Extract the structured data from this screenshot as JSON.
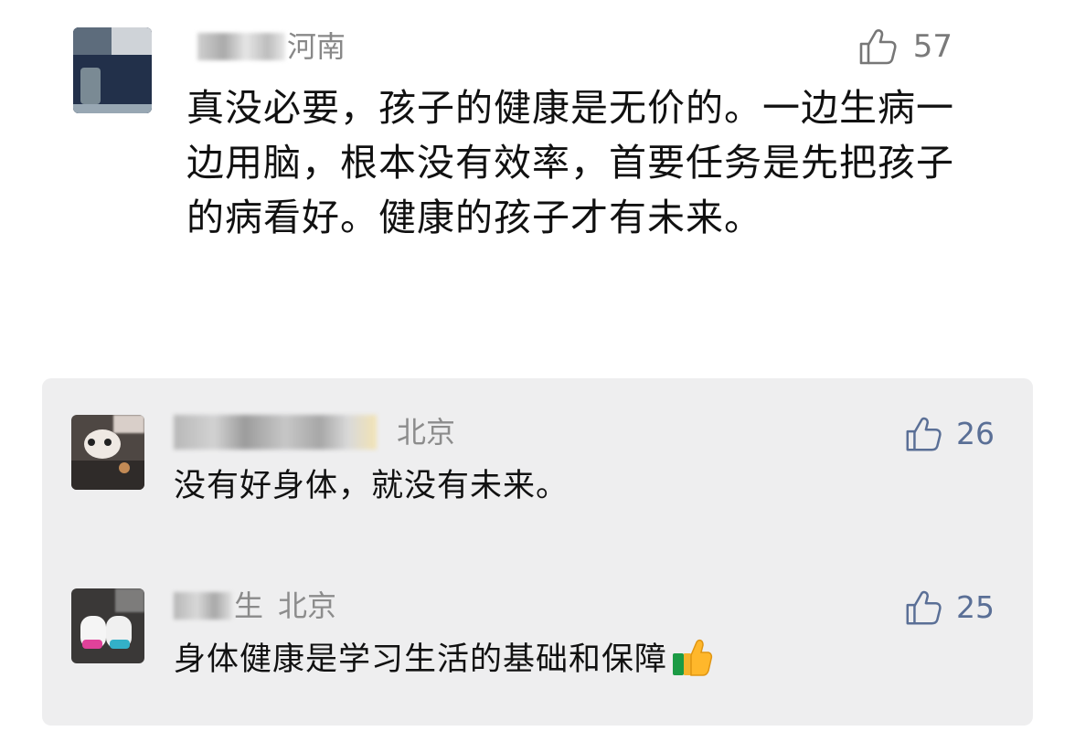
{
  "main_comment": {
    "avatar": "avatar-image",
    "user_name_tail": "",
    "location": "河南",
    "likes": "57",
    "text": "真没必要，孩子的健康是无价的。一边生病一边用脑，根本没有效率，首要任务是先把孩子的病看好。健康的孩子才有未来。"
  },
  "replies": [
    {
      "name_tail": "",
      "location": "北京",
      "likes": "26",
      "text": "没有好身体，就没有未来。"
    },
    {
      "name_tail": "生",
      "location": "北京",
      "likes": "25",
      "text": "身体健康是学习生活的基础和保障",
      "emoji": "thumbs-up-icon"
    }
  ],
  "colors": {
    "muted_text": "#888888",
    "reply_like": "#5a6f96",
    "panel_background": "#eeeeef"
  }
}
